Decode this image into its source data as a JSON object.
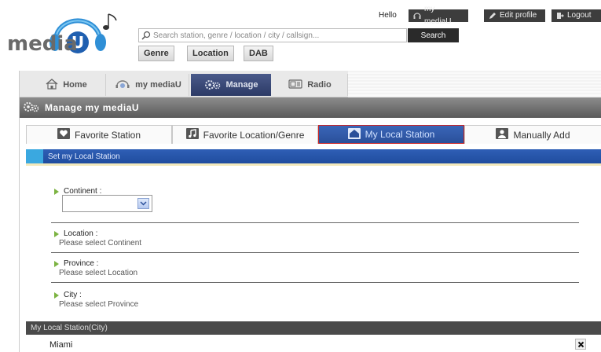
{
  "brand": {
    "logo_text": "media U"
  },
  "search": {
    "placeholder": "Search station, genre / location / city / callsign...",
    "button_label": "Search"
  },
  "filters": [
    {
      "label": "Genre"
    },
    {
      "label": "Location"
    },
    {
      "label": "DAB"
    }
  ],
  "user_bar": {
    "greeting": "Hello",
    "my_mediau": "my mediaU",
    "edit_profile": "Edit profile",
    "logout": "Logout"
  },
  "nav": {
    "tabs": [
      {
        "label": "Home",
        "icon": "house-icon"
      },
      {
        "label": "my mediaU",
        "icon": "headphones-icon"
      },
      {
        "label": "Manage",
        "icon": "gears-icon",
        "active": true
      },
      {
        "label": "Radio",
        "icon": "radio-icon"
      }
    ]
  },
  "section": {
    "title": "Manage my mediaU"
  },
  "subtabs": [
    {
      "label": "Favorite Station",
      "icon": "heart-icon"
    },
    {
      "label": "Favorite Location/Genre",
      "icon": "music-note-icon"
    },
    {
      "label": "My Local Station",
      "icon": "home-icon",
      "active": true
    },
    {
      "label": "Manually Add",
      "icon": "person-icon"
    }
  ],
  "local_station": {
    "header": "Set my Local Station",
    "continent": {
      "label": "Continent :",
      "value": ""
    },
    "location": {
      "label": "Location :",
      "hint": "Please select Continent"
    },
    "province": {
      "label": "Province :",
      "hint": "Please select Location"
    },
    "city": {
      "label": "City :",
      "hint": "Please select Province"
    }
  },
  "my_local_station": {
    "header": "My Local Station(City)",
    "city": "Miami"
  },
  "colors": {
    "accent_blue": "#2f5fb6",
    "dark_bar": "#4a4a4a",
    "active_tab": "#2c3a66",
    "bullet": "#7cb342"
  }
}
